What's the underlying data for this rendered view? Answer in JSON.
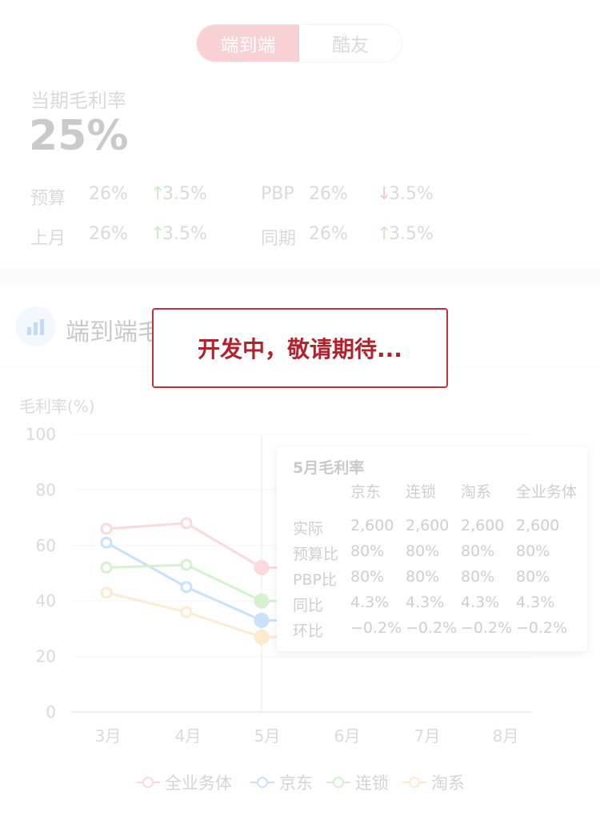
{
  "toggle": {
    "options": [
      "端到端",
      "酷友"
    ],
    "active_index": 0
  },
  "kpi": {
    "label": "当期毛利率",
    "value": "25%"
  },
  "stats": [
    {
      "label": "预算",
      "value": "26%",
      "direction": "up",
      "arrow": "↑",
      "change": "3.5%"
    },
    {
      "label": "PBP",
      "value": "26%",
      "direction": "down",
      "arrow": "↓",
      "change": "3.5%"
    },
    {
      "label": "上月",
      "value": "26%",
      "direction": "up",
      "arrow": "↑",
      "change": "3.5%"
    },
    {
      "label": "同期",
      "value": "26%",
      "direction": "up",
      "arrow": "↑",
      "change": "3.5%"
    }
  ],
  "section": {
    "title": "端到端毛利率趋势",
    "icon": "bar-chart-icon"
  },
  "overlay": {
    "text": "开发中，敬请期待..."
  },
  "colors": {
    "accent": "#ea6e78",
    "up": "#5bbf46",
    "down": "#e84a55",
    "series": [
      "#f08a93",
      "#5aa4ec",
      "#7fd46a",
      "#f7c067"
    ]
  },
  "chart_data": {
    "type": "line",
    "ylabel": "毛利率(%)",
    "ylim": [
      0,
      100
    ],
    "yticks": [
      "0",
      "20",
      "40",
      "60",
      "80",
      "100"
    ],
    "categories": [
      "3月",
      "4月",
      "5月",
      "6月",
      "7月",
      "8月"
    ],
    "highlight_index": 2,
    "grid": true,
    "legend_position": "bottom",
    "series": [
      {
        "name": "全业务体",
        "values": [
          66,
          68,
          52,
          null,
          null,
          null
        ]
      },
      {
        "name": "京东",
        "values": [
          61,
          45,
          33,
          null,
          null,
          null
        ]
      },
      {
        "name": "连锁",
        "values": [
          52,
          53,
          40,
          null,
          null,
          null
        ]
      },
      {
        "name": "淘系",
        "values": [
          43,
          36,
          27,
          null,
          null,
          null
        ]
      }
    ],
    "tooltip": {
      "title": "5月毛利率",
      "columns": [
        "京东",
        "连锁",
        "淘系",
        "全业务体"
      ],
      "rows": [
        {
          "label": "实际",
          "values": [
            "2,600",
            "2,600",
            "2,600",
            "2,600"
          ]
        },
        {
          "label": "预算比",
          "values": [
            "80%",
            "80%",
            "80%",
            "80%"
          ]
        },
        {
          "label": "PBP比",
          "values": [
            "80%",
            "80%",
            "80%",
            "80%"
          ]
        },
        {
          "label": "同比",
          "values": [
            "4.3%",
            "4.3%",
            "4.3%",
            "4.3%"
          ]
        },
        {
          "label": "环比",
          "values": [
            "−0.2%",
            "−0.2%",
            "−0.2%",
            "−0.2%"
          ]
        }
      ]
    }
  }
}
